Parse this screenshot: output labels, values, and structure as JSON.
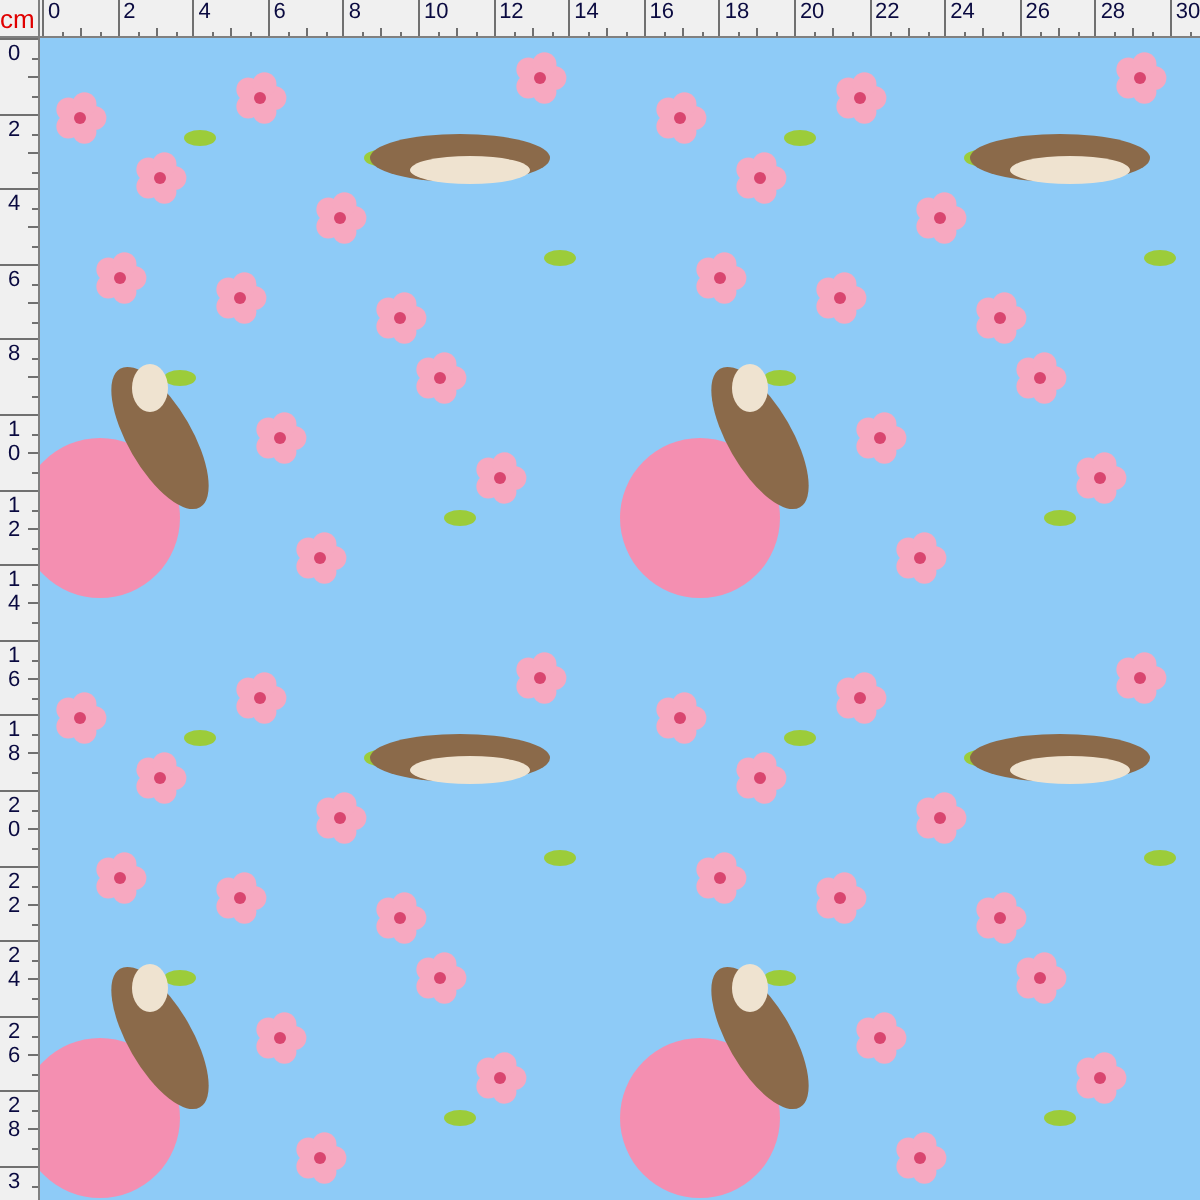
{
  "unit": "cm",
  "ruler_top": {
    "labels": [
      "0",
      "2",
      "4",
      "6",
      "8",
      "10",
      "12",
      "14",
      "16",
      "18",
      "20",
      "22",
      "24",
      "26",
      "28",
      "30"
    ]
  },
  "ruler_left": {
    "labels": [
      "0",
      "2",
      "4",
      "6",
      "8",
      "10",
      "12",
      "14",
      "16",
      "18",
      "20",
      "22",
      "24",
      "26",
      "28",
      "3"
    ]
  }
}
